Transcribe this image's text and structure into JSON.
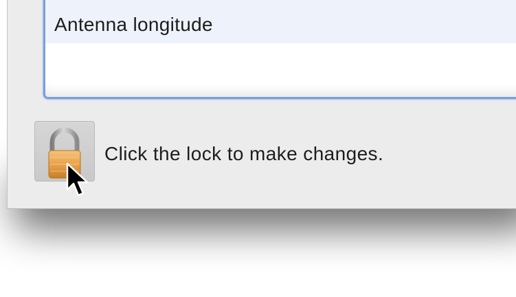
{
  "list": {
    "rows": [
      {
        "label": "Antenna longitude"
      }
    ]
  },
  "lock": {
    "icon": "lock-icon",
    "state": "locked",
    "hint": "Click the lock to make changes."
  },
  "cursor": {
    "icon": "arrow-cursor-icon"
  },
  "colors": {
    "window_bg": "#ececec",
    "focus_ring": "#7b9edb",
    "row_highlight": "#eef2fb",
    "lock_body": "#e8a14a",
    "lock_shackle": "#9a9a9a",
    "text": "#1d1d1d"
  }
}
